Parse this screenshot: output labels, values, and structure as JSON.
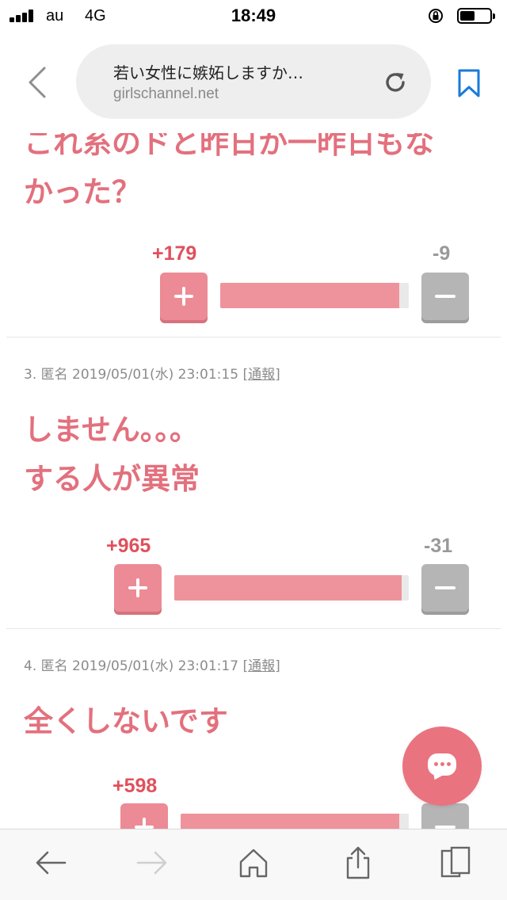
{
  "status_bar": {
    "carrier": "au",
    "network": "4G",
    "time": "18:49",
    "battery_level": 0.5
  },
  "browser": {
    "page_title": "若い女性に嫉妬しますか…",
    "domain": "girlschannel.net",
    "accent_color": "#1a7ad9"
  },
  "comments": [
    {
      "text_lines": [
        "これ系のドと昨日か一昨日もな",
        "かった？"
      ],
      "plus": "+179",
      "minus": "-9",
      "plus_ratio": 0.95
    },
    {
      "meta": {
        "number_name_date": "3. 匿名 2019/05/01(水) 23:01:15 ",
        "report_open": "[",
        "report": "通報",
        "report_close": "]"
      },
      "text_lines": [
        "しません。。。",
        "する人が異常"
      ],
      "plus": "+965",
      "minus": "-31",
      "plus_ratio": 0.97
    },
    {
      "meta": {
        "number_name_date": "4. 匿名 2019/05/01(水) 23:01:17 ",
        "report_open": "[",
        "report": "通報",
        "report_close": "]"
      },
      "text_lines": [
        "全くしないです"
      ],
      "plus": "+598",
      "minus": "",
      "plus_ratio": 0.96
    }
  ],
  "colors": {
    "comment_text": "#e3707d",
    "plus": "#e0505c",
    "plus_button": "#ec8b95",
    "minus_button": "#b5b5b5",
    "chat_button": "#ea7380"
  },
  "icons": {
    "back": "chevron-left-icon",
    "reload": "reload-icon",
    "bookmark": "bookmark-icon",
    "chat": "chat-bubble-icon",
    "toolbar": [
      "arrow-left-icon",
      "arrow-right-icon",
      "home-icon",
      "share-icon",
      "tabs-icon"
    ]
  }
}
